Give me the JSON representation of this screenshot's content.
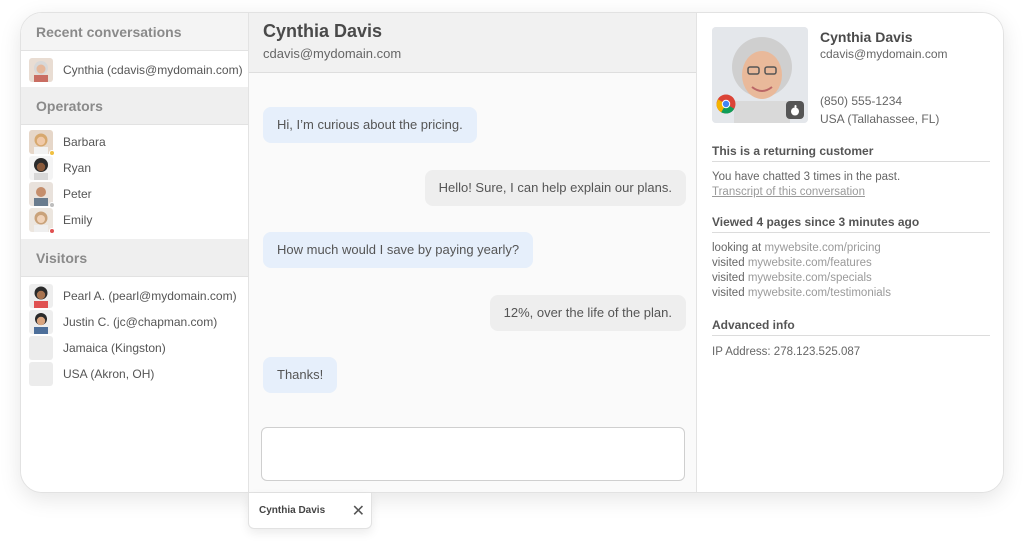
{
  "sidebar": {
    "recent_heading": "Recent conversations",
    "recent": [
      {
        "label": "Cynthia (cdavis@mydomain.com)"
      }
    ],
    "operators_heading": "Operators",
    "operators": [
      {
        "label": "Barbara",
        "status_color": "#f0c040"
      },
      {
        "label": "Ryan",
        "status_color": ""
      },
      {
        "label": "Peter",
        "status_color": "#bdbdbd"
      },
      {
        "label": "Emily",
        "status_color": "#e05050"
      }
    ],
    "visitors_heading": "Visitors",
    "visitors": [
      {
        "label": "Pearl A. (pearl@mydomain.com)"
      },
      {
        "label": "Justin C. (jc@chapman.com)"
      },
      {
        "label": "Jamaica (Kingston)"
      },
      {
        "label": "USA (Akron, OH)"
      }
    ]
  },
  "chat": {
    "name": "Cynthia Davis",
    "email": "cdavis@mydomain.com",
    "messages": [
      {
        "from": "visitor",
        "text": "Hi, I’m curious about the pricing."
      },
      {
        "from": "operator",
        "text": "Hello! Sure, I can help explain our plans."
      },
      {
        "from": "visitor",
        "text": "How much would I save by paying yearly?"
      },
      {
        "from": "operator",
        "text": "12%, over the life of the plan."
      },
      {
        "from": "visitor",
        "text": "Thanks!"
      }
    ],
    "composer_value": ""
  },
  "details": {
    "name": "Cynthia Davis",
    "email": "cdavis@mydomain.com",
    "phone": "(850) 555-1234",
    "location": "USA (Tallahassee, FL)",
    "browser_icon": "chrome-icon",
    "os_icon": "apple-icon",
    "returning_heading": "This is a returning customer",
    "returning_text": "You have chatted 3 times in the past.",
    "transcript_link": "Transcript of this conversation",
    "pages_heading": "Viewed 4 pages since 3 minutes ago",
    "pages": [
      {
        "verb": "looking at",
        "url": "mywebsite.com/pricing"
      },
      {
        "verb": "visited",
        "url": "mywebsite.com/features"
      },
      {
        "verb": "visited",
        "url": "mywebsite.com/specials"
      },
      {
        "verb": "visited",
        "url": "mywebsite.com/testimonials"
      }
    ],
    "advanced_heading": "Advanced info",
    "ip_text": "IP Address: 278.123.525.087"
  },
  "tab": {
    "label": "Cynthia Davis",
    "close_icon": "close-icon"
  }
}
